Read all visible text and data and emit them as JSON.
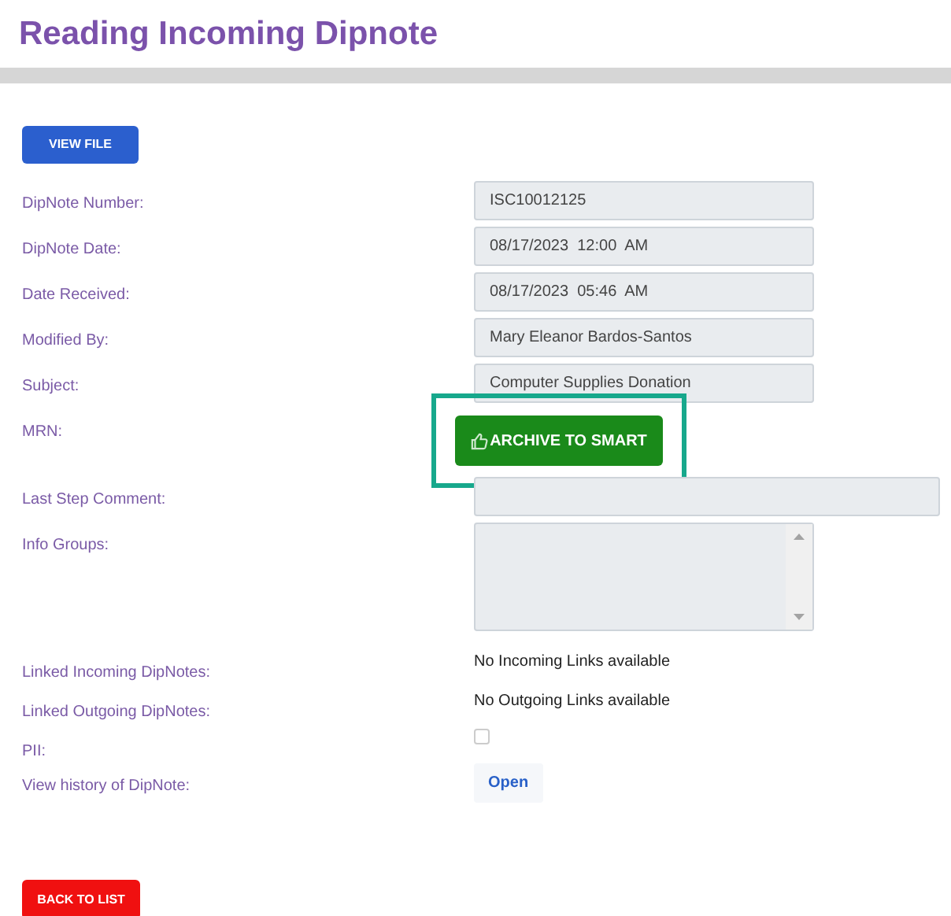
{
  "title": "Reading Incoming Dipnote",
  "view_file_button": "VIEW FILE",
  "rows": [
    {
      "kind": "field",
      "label": "DipNote Number:",
      "value": "ISC10012125"
    },
    {
      "kind": "field",
      "label": "DipNote Date:",
      "value": "08/17/2023  12:00  AM"
    },
    {
      "kind": "field",
      "label": "Date Received:",
      "value": "08/17/2023  05:46  AM"
    },
    {
      "kind": "field",
      "label": "Modified By:",
      "value": "Mary Eleanor Bardos-Santos"
    },
    {
      "kind": "field",
      "label": "Subject:",
      "value": "Computer Supplies Donation"
    },
    {
      "kind": "action",
      "label": "MRN:",
      "button": "ARCHIVE TO SMART",
      "highlighted": true
    },
    {
      "kind": "wide_field",
      "label": "Last Step Comment:"
    },
    {
      "kind": "listbox",
      "label": "Info Groups:"
    },
    {
      "kind": "text",
      "label": "Linked Incoming DipNotes:",
      "value": "No Incoming Links available"
    },
    {
      "kind": "text",
      "label": "Linked Outgoing DipNotes:",
      "value": "No Outgoing Links available"
    },
    {
      "kind": "checkbox",
      "label": "PII:",
      "checked": false
    },
    {
      "kind": "link_button",
      "label": "View history of DipNote:",
      "button": "Open"
    }
  ],
  "back_button": "BACK TO LIST"
}
